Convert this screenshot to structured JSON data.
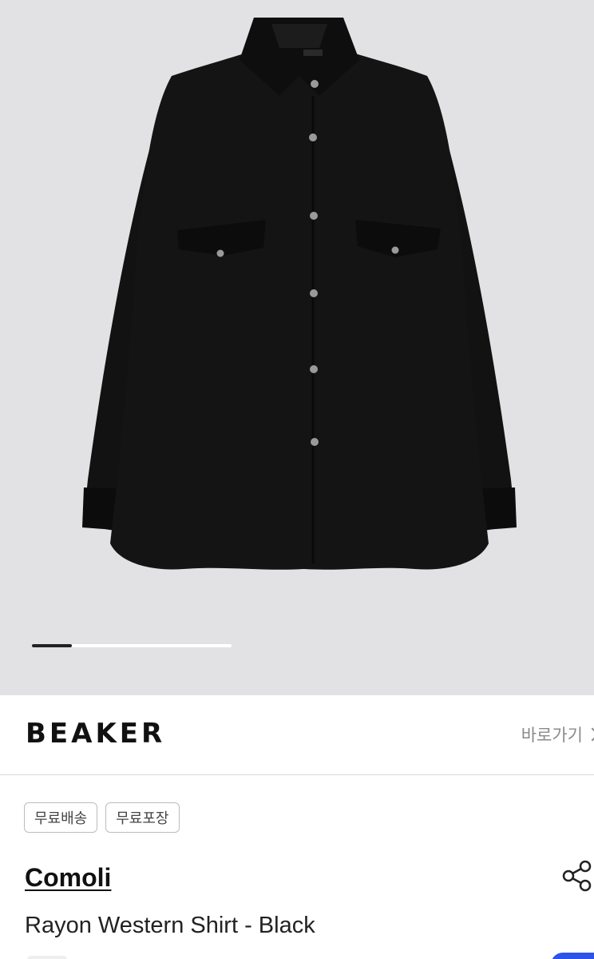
{
  "gallery": {
    "image": "black-rayon-western-shirt-photo",
    "label_tag": "COMOLI",
    "slide_progress": 0.2,
    "background_color": "#e2e2e4"
  },
  "brand_bar": {
    "logo": "BEAKER",
    "shortcut_label": "바로가기",
    "shortcut_icon": "chevron-right-icon"
  },
  "tags": [
    {
      "label": "무료배송"
    },
    {
      "label": "무료포장"
    }
  ],
  "product": {
    "brand": "Comoli",
    "name": "Rayon Western Shirt - Black",
    "share_icon": "share-icon"
  },
  "colors": {
    "accent": "#2c55e8",
    "text": "#111111",
    "muted": "#8a8a8a"
  }
}
